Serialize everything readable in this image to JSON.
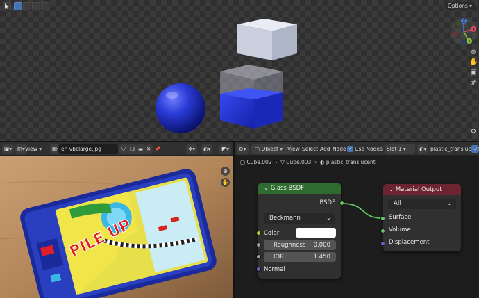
{
  "viewport": {
    "options_label": "Options",
    "gizmo_axes": [
      "X",
      "Y",
      "Z"
    ],
    "side_icons": [
      "zoom-icon",
      "hand-icon",
      "camera-icon",
      "grid-icon"
    ]
  },
  "image_editor": {
    "view_menu": "View",
    "image_name": "en vbclarge.jpg",
    "photo": {
      "headline": "PILE UP"
    }
  },
  "node_editor": {
    "object_mode": "Object",
    "menus": [
      "View",
      "Select",
      "Add",
      "Node"
    ],
    "use_nodes_label": "Use Nodes",
    "slot": "Slot 1",
    "material": "plastic_translucent",
    "breadcrumb": [
      "Cube.002",
      "Cube.003",
      "plastic_translucent"
    ],
    "glass_node": {
      "title": "Glass BSDF",
      "output": "BSDF",
      "distribution": "Beckmann",
      "color_label": "Color",
      "color_value": "#ffffff",
      "roughness_label": "Roughness",
      "roughness_value": "0.000",
      "ior_label": "IOR",
      "ior_value": "1.450",
      "normal_label": "Normal",
      "header_color": "#2e6b2e"
    },
    "output_node": {
      "title": "Material Output",
      "target": "All",
      "inputs": [
        "Surface",
        "Volume",
        "Displacement"
      ],
      "header_color": "#6b2430"
    }
  },
  "colors": {
    "accent": "#4772b3",
    "shader_socket": "#63c763",
    "color_socket": "#c7c729",
    "value_socket": "#a1a1a1",
    "vector_socket": "#6363c7"
  }
}
